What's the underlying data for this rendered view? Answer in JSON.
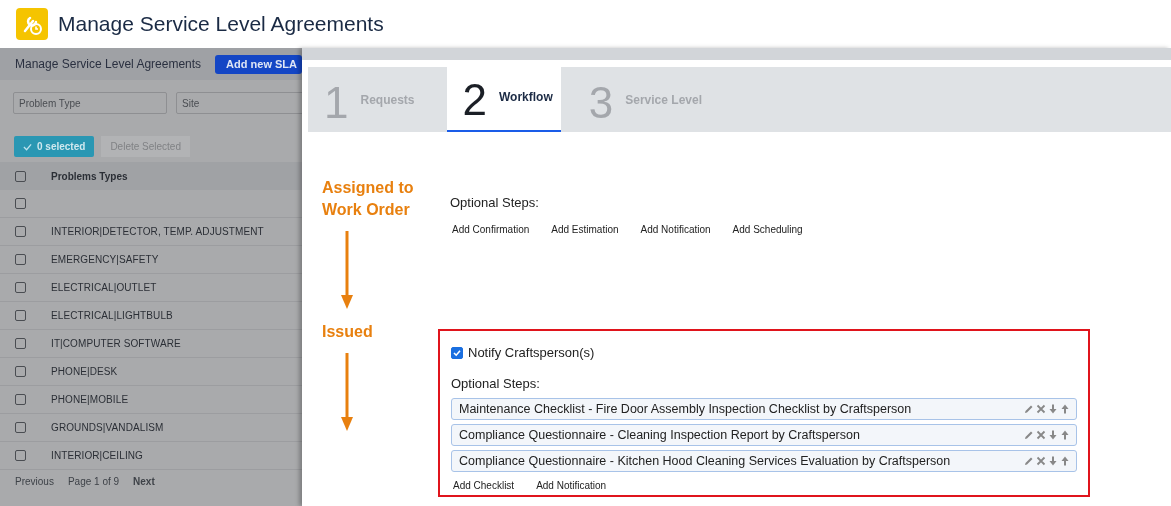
{
  "app": {
    "title": "Manage Service Level Agreements"
  },
  "list_panel": {
    "title": "Manage Service Level Agreements",
    "add_button": "Add new SLA",
    "filters": [
      {
        "placeholder": "Problem Type"
      },
      {
        "placeholder": "Site"
      }
    ],
    "selected_button": "0 selected",
    "delete_button": {
      "label": "Delete Selected",
      "disabled": true
    },
    "table": {
      "columns": [
        "Problems Types"
      ],
      "header_checked": false,
      "rows": [
        {
          "checked": false
        },
        {
          "problem_type": "INTERIOR|DETECTOR, TEMP. ADJUSTMENT",
          "checked": false
        },
        {
          "problem_type": "EMERGENCY|SAFETY",
          "checked": false
        },
        {
          "problem_type": "ELECTRICAL|OUTLET",
          "checked": false
        },
        {
          "problem_type": "ELECTRICAL|LIGHTBULB",
          "checked": false
        },
        {
          "problem_type": "IT|COMPUTER SOFTWARE",
          "checked": false
        },
        {
          "problem_type": "PHONE|DESK",
          "checked": false
        },
        {
          "problem_type": "PHONE|MOBILE",
          "checked": false
        },
        {
          "problem_type": "GROUNDS|VANDALISM",
          "checked": false
        },
        {
          "problem_type": "INTERIOR|CEILING",
          "checked": false
        }
      ]
    },
    "pager": {
      "previous": "Previous",
      "page": "Page 1 of 9",
      "next": "Next"
    }
  },
  "wizard": {
    "steps": [
      {
        "number": "1",
        "label": "Requests",
        "selected": false
      },
      {
        "number": "2",
        "label": "Workflow",
        "selected": true
      },
      {
        "number": "3",
        "label": "Service Level",
        "selected": false
      }
    ],
    "stages": [
      {
        "title": "Assigned to Work Order",
        "highlighted": false,
        "optional_label": "Optional Steps:",
        "add_links": [
          "Add Confirmation",
          "Add Estimation",
          "Add Notification",
          "Add Scheduling"
        ]
      },
      {
        "title": "Issued",
        "highlighted": true,
        "notify": {
          "label": "Notify Craftsperson(s)",
          "checked": true
        },
        "optional_label": "Optional Steps:",
        "steps": [
          "Maintenance Checklist - Fire Door Assembly Inspection Checklist by Craftsperson",
          "Compliance Questionnaire - Cleaning Inspection Report by Craftsperson",
          "Compliance Questionnaire - Kitchen Hood Cleaning Services Evaluation by Craftsperson"
        ],
        "add_links": [
          "Add Checklist",
          "Add Notification"
        ]
      }
    ]
  }
}
